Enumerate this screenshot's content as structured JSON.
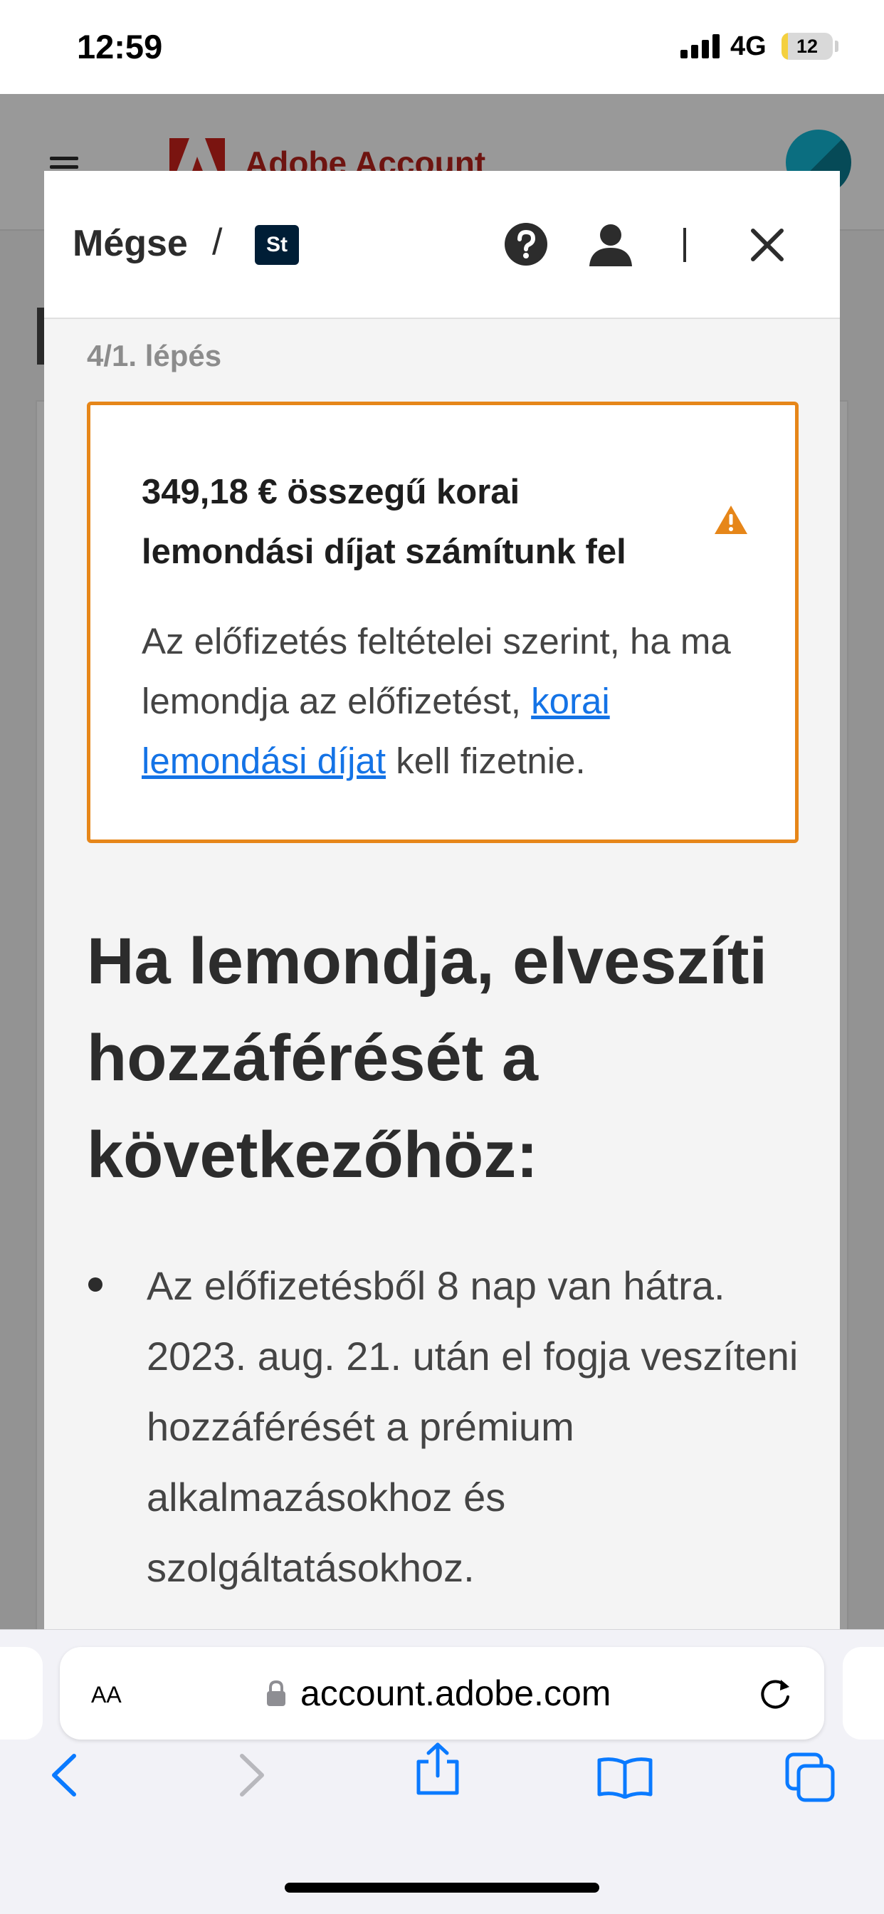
{
  "status_bar": {
    "time": "12:59",
    "network": "4G",
    "battery_level": "12",
    "battery_fraction": 0.12
  },
  "background_page": {
    "brand": "Adobe Account",
    "colors": {
      "brand_red": "#fa0f00",
      "avatar": "#0b6e80"
    }
  },
  "modal": {
    "header": {
      "cancel_label": "Mégse",
      "separator": "/",
      "app_badge": "St",
      "icons": [
        "help-icon",
        "user-icon",
        "close-icon"
      ]
    },
    "step_label": "4/1. lépés",
    "warning": {
      "title": "349,18 € összegű korai lemondási díjat számítunk fel",
      "text_before": "Az előfizetés feltételei szerint, ha ma lemondja az előfizetést, ",
      "link_label": "korai lemondási díjat",
      "text_after": " kell fizetnie.",
      "border_color": "#e68619",
      "link_color": "#1473e6"
    },
    "loss_heading": "Ha lemondja, elveszíti hozzáférését a következőhöz:",
    "loss_items": [
      "Az előfizetésből 8 nap van hátra. 2023. aug. 21. után el fogja veszíteni hozzáférését a prémium alkalmazásokhoz és szolgáltatásokhoz."
    ]
  },
  "safari": {
    "text_size_button": "AA",
    "url": "account.adobe.com",
    "toolbar_icons": [
      "back-icon",
      "forward-icon",
      "share-icon",
      "bookmarks-icon",
      "tabs-icon"
    ]
  }
}
